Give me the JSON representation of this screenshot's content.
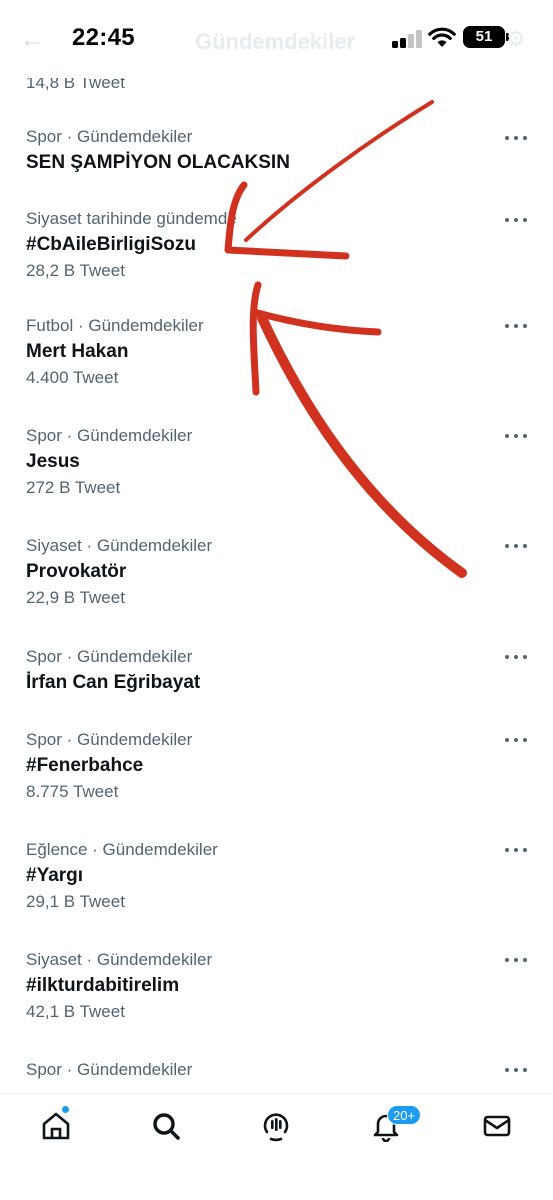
{
  "status_bar": {
    "time": "22:45",
    "battery": "51",
    "back_glyph": "←",
    "title_behind": "Gündemdekiler",
    "gear_glyph": "⚙"
  },
  "trends": [
    {
      "context": "",
      "name": "",
      "count": "14,8 B Tweet"
    },
    {
      "context": "Spor · Gündemdekiler",
      "name": "SEN ŞAMPİYON OLACAKSIN",
      "count": ""
    },
    {
      "context": "Siyaset tarihinde gündemde",
      "name": "#CbAileBirligiSozu",
      "count": "28,2 B Tweet"
    },
    {
      "context": "Futbol · Gündemdekiler",
      "name": "Mert Hakan",
      "count": "4.400 Tweet"
    },
    {
      "context": "Spor · Gündemdekiler",
      "name": "Jesus",
      "count": "272 B Tweet"
    },
    {
      "context": "Siyaset · Gündemdekiler",
      "name": "Provokatör",
      "count": "22,9 B Tweet"
    },
    {
      "context": "Spor · Gündemdekiler",
      "name": "İrfan Can Eğribayat",
      "count": ""
    },
    {
      "context": "Spor · Gündemdekiler",
      "name": "#Fenerbahce",
      "count": "8.775 Tweet"
    },
    {
      "context": "Eğlence · Gündemdekiler",
      "name": "#Yargı",
      "count": "29,1 B Tweet"
    },
    {
      "context": "Siyaset · Gündemdekiler",
      "name": "#ilkturdabitirelim",
      "count": "42,1 B Tweet"
    },
    {
      "context": "Spor · Gündemdekiler",
      "name": "",
      "count": ""
    }
  ],
  "bottom_nav": {
    "items": [
      "home-icon",
      "search-icon",
      "spaces-icon",
      "notifications-icon",
      "messages-icon"
    ],
    "notification_badge": "20+"
  },
  "colors": {
    "accent": "#1d9bf0",
    "secondary_text": "#536471",
    "primary_text": "#0f1419",
    "annotation": "#d0321f"
  }
}
